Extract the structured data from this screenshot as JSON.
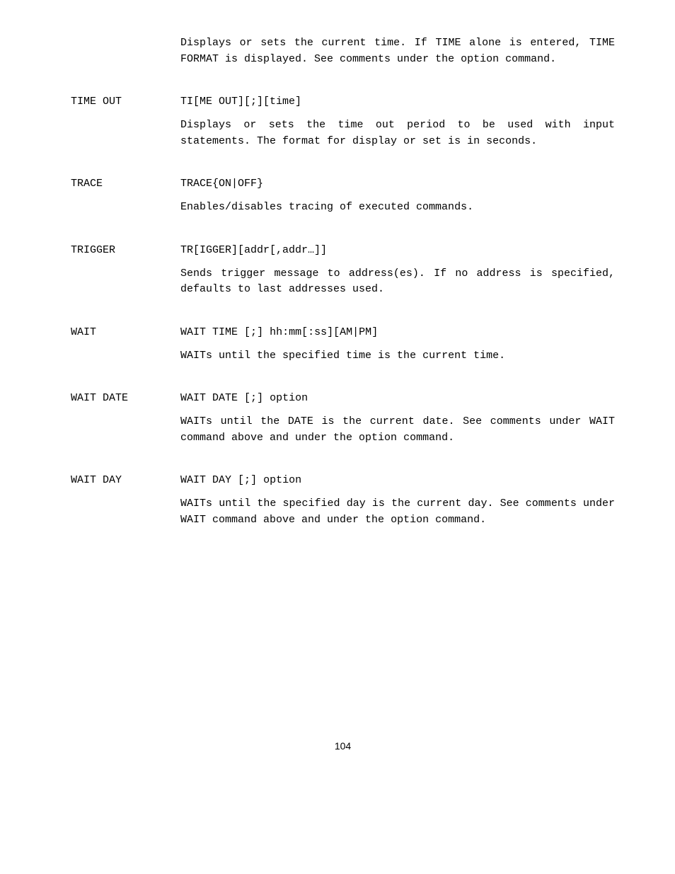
{
  "intro": {
    "line1a": "Displays or sets the current time. If ",
    "line1_time": "TIME",
    "line1b": " alone is entered, ",
    "line1_tf": "TIME FORMAT",
    "line2a": " is displayed. See comments under the ",
    "line2_opt": "option",
    "line2b": " command."
  },
  "timeout": {
    "label": "TIME OUT",
    "syntax": "TI[ME OUT][;][time]",
    "desc1a": "Displays or sets the ",
    "desc1_time": "time",
    "desc1b": " out period to be used with input statements. The format for display or set is in seconds."
  },
  "trace": {
    "label": "TRACE",
    "syntax": "TRACE{ON|OFF}",
    "desc": "Enables/disables tracing of executed commands."
  },
  "trigger": {
    "label": "TRIGGER",
    "syntax": "TR[IGGER][addr[,addr…]]",
    "desc": "Sends trigger message to address(es). If no address is specified, defaults to last addresses used."
  },
  "wait": {
    "label": "WAIT",
    "syntax_a": "WAIT TIME",
    "syntax_b": ";",
    "syntax_c": "hh:mm",
    "syntax_d": ":ss",
    "syntax_e": "AM",
    "syntax_f": "PM",
    "desc_a": "WAIT",
    "desc_b": "s until the specified time is the current time."
  },
  "waitdate": {
    "label": "WAIT DATE",
    "syntax_a": "WAIT DATE",
    "syntax_b": ";",
    "syntax_c": "option",
    "desc_wait": "WAIT",
    "desc_mid1": "s until the ",
    "desc_date": "DATE",
    "desc_mid2": " is the current date. See comments under ",
    "desc_wait2": "WAIT",
    "desc_mid3": " command above and under the ",
    "desc_opt": "option",
    "desc_end": " command."
  },
  "waitday": {
    "label": "WAIT DAY",
    "syntax_a": "WAIT DAY",
    "syntax_b": ";",
    "syntax_c": "option",
    "desc_wait": "WAIT",
    "desc_mid1": "s until the specified day is the current day. See comments under ",
    "desc_wait2": "WAIT",
    "desc_mid2": " command above and under the ",
    "desc_opt": "option",
    "desc_end": " command."
  },
  "pagenum": "104"
}
